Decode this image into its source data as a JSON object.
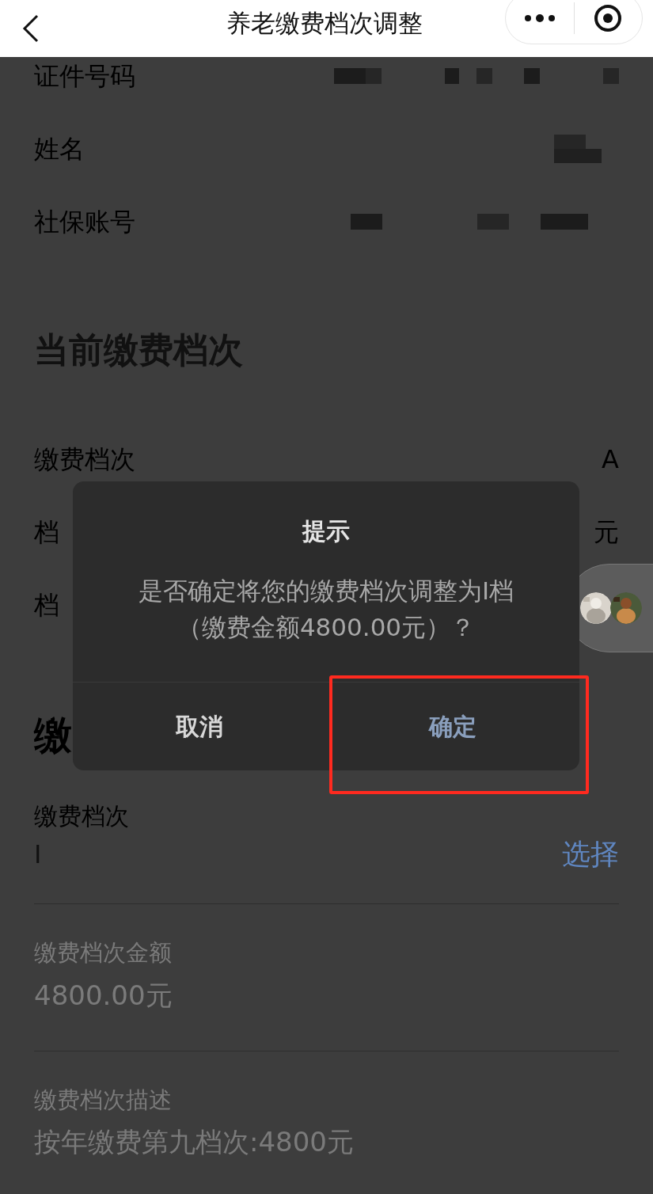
{
  "header": {
    "title": "养老缴费档次调整"
  },
  "identity_rows": [
    {
      "label": "证件号码"
    },
    {
      "label": "姓名"
    },
    {
      "label": "社保账号"
    }
  ],
  "current": {
    "heading": "当前缴费档次",
    "rows": [
      {
        "label": "缴费档次",
        "value": "A"
      },
      {
        "label": "档",
        "value": "元"
      },
      {
        "label": "档"
      }
    ]
  },
  "new_section": {
    "heading": "缴",
    "field_label": "缴费档次",
    "field_value": "I",
    "select_link": "选择",
    "details": [
      {
        "label": "缴费档次金额",
        "value": "4800.00元"
      },
      {
        "label": "缴费档次描述",
        "value": "按年缴费第九档次:4800元"
      }
    ]
  },
  "dialog": {
    "title": "提示",
    "message": "是否确定将您的缴费档次调整为I档（缴费金额4800.00元）？",
    "buttons": [
      {
        "label": "取消",
        "kind": "cancel",
        "highlighted": false
      },
      {
        "label": "确定",
        "kind": "confirm",
        "highlighted": true
      }
    ]
  }
}
